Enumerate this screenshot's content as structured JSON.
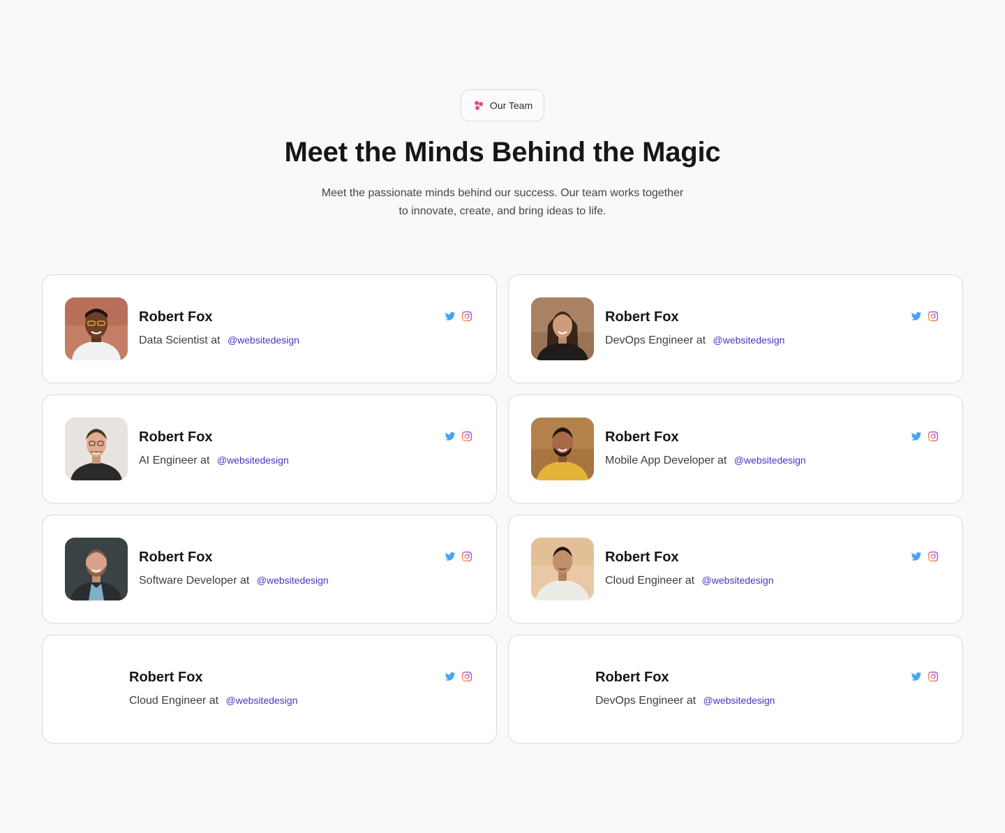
{
  "header": {
    "badge_label": "Our Team",
    "title": "Meet the Minds Behind the Magic",
    "subtitle_line1": "Meet the passionate minds behind our success. Our team works together",
    "subtitle_line2": "to innovate, create, and bring ideas to life."
  },
  "colors": {
    "accent_pink": "#e8488b",
    "handle": "#4a34c2",
    "twitter": "#4aa3ef",
    "instagram": "#e45a8c"
  },
  "members": [
    {
      "name": "Robert Fox",
      "role": "Data Scientist at",
      "handle": "@websitedesign"
    },
    {
      "name": "Robert Fox",
      "role": "DevOps Engineer at",
      "handle": "@websitedesign"
    },
    {
      "name": "Robert Fox",
      "role": "AI Engineer at",
      "handle": "@websitedesign"
    },
    {
      "name": "Robert Fox",
      "role": "Mobile App Developer at",
      "handle": "@websitedesign"
    },
    {
      "name": "Robert Fox",
      "role": "Software Developer at",
      "handle": "@websitedesign"
    },
    {
      "name": "Robert Fox",
      "role": "Cloud Engineer at",
      "handle": "@websitedesign"
    },
    {
      "name": "Robert Fox",
      "role": "Cloud Engineer at",
      "handle": "@websitedesign"
    },
    {
      "name": "Robert Fox",
      "role": "DevOps Engineer at",
      "handle": "@websitedesign"
    }
  ],
  "icons": {
    "badge": "team-dots-icon",
    "twitter": "twitter-icon",
    "instagram": "instagram-icon"
  }
}
